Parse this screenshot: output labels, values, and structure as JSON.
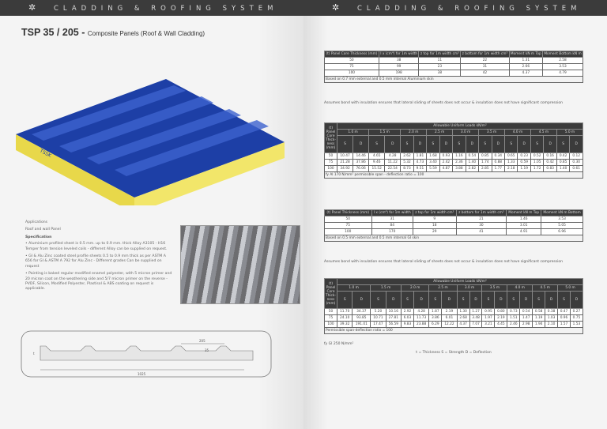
{
  "header": {
    "left": "CLADDING & ROOFING SYSTEM",
    "right": "CLADDING & ROOFING SYSTEM"
  },
  "left": {
    "title": "TSP 35 / 205 -",
    "subtitle": "Composite Panels (Roof & Wall Cladding)",
    "panel_label": "TSSK",
    "applications": "Applications",
    "applications_value": "Roof and wall Panel",
    "spec_heading": "Specification",
    "spec": [
      "• Aluminium profiled sheet is 0.5 mm. up to 0.9 mm. thick Alloy A3105 - H16 Temper from tension leveled coils - different Alloy can be supplied on request.",
      "• GI & Alu Zinc coated steel profile sheets 0.5 to 0.9 mm thick as per ASTM A 656 for GI & ASTM A 792 for Alu Zinc - Different grades Can be supplied on request",
      "• Painting is baked regular modified enamel polyester, with 5 micron primer and 20 micron coat on the weathering side and 5/7 micron primer on the reverse - PVDF, Silicon, Modified Polyester, Plastisol & ABS coating on request is applicable."
    ],
    "drawing": {
      "pitch": "205",
      "height": "35",
      "thick": "t",
      "width": "1025"
    }
  },
  "right": {
    "props_headers": [
      "(t) Panel Core Thickness (mm)",
      "I x (cm⁴) for 1m width",
      "z top for 1m width cm³",
      "z bottom for 1m width cm³",
      "Moment kN m Top",
      "Moment Bottom kN m"
    ],
    "table1": {
      "rows": [
        [
          "50",
          "38",
          "11",
          "22",
          "1.31",
          "2.58"
        ],
        [
          "75",
          "99",
          "23",
          "31",
          "2.66",
          "3.53"
        ],
        [
          "100",
          "198",
          "38",
          "42",
          "4.37",
          "4.79"
        ]
      ],
      "note": "Based on 0.7 mm external and 0.5 mm internal Aluminium skin"
    },
    "bond_note": "Assumes bond with insulation ensures that lateral sliding of sheets does not occur & insulation does not have significant compression",
    "load_header": "(t) Panel Core Thick-ness (mm)",
    "load_title": "Allowable Uniform Loads kN/m²",
    "spans": [
      "1.0 m",
      "1.5 m",
      "2.0 m",
      "2.5 m",
      "3.0 m",
      "3.5 m",
      "4.0 m",
      "4.5 m",
      "5.0 m"
    ],
    "sd": [
      "S",
      "D"
    ],
    "table2": {
      "rows": [
        [
          "50",
          "10.47",
          "14.46",
          "4.65",
          "4.28",
          "2.62",
          "1.81",
          "1.68",
          "0.93",
          "1.16",
          "0.54",
          "0.85",
          "0.34",
          "0.65",
          "0.23",
          "0.52",
          "0.16",
          "0.42",
          "0.12"
        ],
        [
          "75",
          "21.28",
          "37.86",
          "9.46",
          "11.22",
          "5.32",
          "4.73",
          "3.40",
          "2.42",
          "2.36",
          "1.40",
          "1.74",
          "0.88",
          "1.33",
          "0.59",
          "1.05",
          "0.42",
          "0.85",
          "0.30"
        ],
        [
          "100",
          "34.92",
          "76.06",
          "15.52",
          "22.54",
          "8.73",
          "9.51",
          "5.59",
          "4.87",
          "3.88",
          "2.82",
          "2.85",
          "1.77",
          "2.18",
          "1.19",
          "1.72",
          "0.83",
          "1.40",
          "0.61"
        ]
      ],
      "note": "fy Al 170 N/mm² permissible span - deflection ratio = 100"
    },
    "props_headers2": [
      "(t) Panel Thickness (mm)",
      "I x (cm⁴) for 1m width",
      "z top for 1m width cm³",
      "z bottom for 1m width cm³",
      "Moment kN m Top",
      "Moment kN m Bottom"
    ],
    "table3": {
      "rows": [
        [
          "50",
          "31",
          "9",
          "21",
          "1.46",
          "3.53"
        ],
        [
          "75",
          "84",
          "18",
          "30",
          "3.01",
          "5.05"
        ],
        [
          "100",
          "170",
          "29",
          "41",
          "4.91",
          "6.96"
        ]
      ],
      "note": "Based on 0.5 mm external and 0.5 mm internal GI skin"
    },
    "table4": {
      "rows": [
        [
          "50",
          "11.70",
          "34.37",
          "5.20",
          "10.16",
          "2.92",
          "4.28",
          "1.87",
          "2.19",
          "1.30",
          "1.27",
          "0.95",
          "0.80",
          "0.73",
          "0.54",
          "0.58",
          "0.38",
          "0.47",
          "0.27"
        ],
        [
          "75",
          "24.10",
          "93.85",
          "10.71",
          "27.81",
          "6.03",
          "11.73",
          "3.86",
          "6.01",
          "2.68",
          "3.48",
          "1.97",
          "2.19",
          "1.51",
          "1.47",
          "1.19",
          "1.03",
          "0.96",
          "0.75"
        ],
        [
          "100",
          "39.32",
          "191.01",
          "17.47",
          "56.59",
          "9.83",
          "23.88",
          "6.29",
          "12.22",
          "4.37",
          "7.07",
          "3.21",
          "4.45",
          "2.46",
          "2.98",
          "1.94",
          "2.10",
          "1.57",
          "1.53"
        ]
      ],
      "note": "Permissible span-deflection ratio = 100"
    },
    "fy_note": "fy GI 250 N/mm²",
    "legend": "t = Thickness S = Strength D = Deflection"
  }
}
